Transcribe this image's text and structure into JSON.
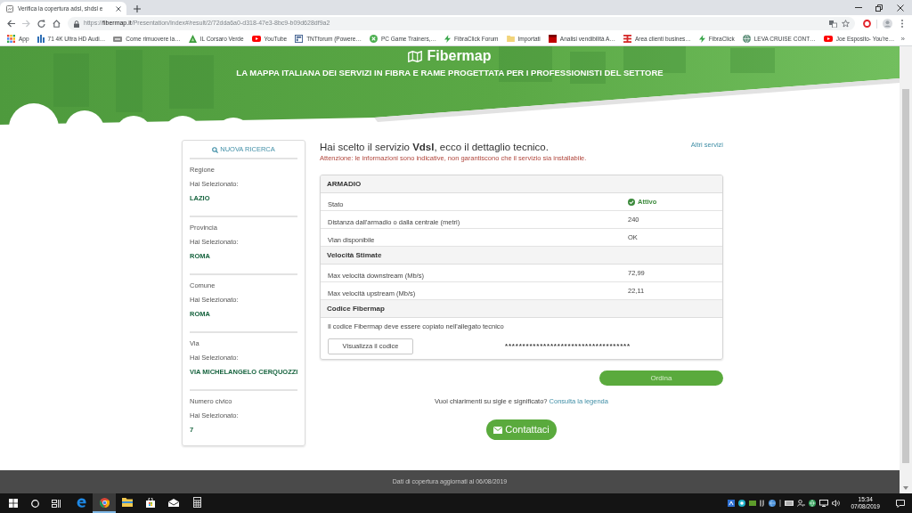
{
  "browser": {
    "tab": {
      "title": "Verifica la copertura adsl, shdsl e"
    },
    "nav": {
      "forward_disabled": true
    },
    "url": {
      "scheme": "https://",
      "host": "fibermap.it",
      "path": "/Presentation/Index#/result/2/72dda6a0-d318-47e3-8bc9-b09d628df9a2"
    },
    "bookmarks": {
      "items": [
        {
          "label": "App"
        },
        {
          "label": "71 4K Ultra HD Audi…"
        },
        {
          "label": "Come rimuovere la…"
        },
        {
          "label": "IL Corsaro Verde"
        },
        {
          "label": "YouTube"
        },
        {
          "label": "TNTforum (Powere…"
        },
        {
          "label": "PC Game Trainers,…"
        },
        {
          "label": "FibraClick Forum"
        },
        {
          "label": "Importati"
        },
        {
          "label": "Analisi vendibilità A…"
        },
        {
          "label": "Area clienti busines…"
        },
        {
          "label": "FibraClick"
        },
        {
          "label": "LEVA CRUISE CONT…"
        },
        {
          "label": "Joe Esposito- You're…"
        }
      ],
      "more": "»"
    }
  },
  "banner": {
    "logo": "Fibermap",
    "tagline": "LA MAPPA ITALIANA DEI SERVIZI IN FIBRA E RAME PROGETTATA PER I PROFESSIONISTI DEL SETTORE"
  },
  "search": {
    "new_search": "NUOVA RICERCA",
    "fields": [
      {
        "label": "Regione",
        "hint": "Hai Selezionato:",
        "value": "LAZIO"
      },
      {
        "label": "Provincia",
        "hint": "Hai Selezionato:",
        "value": "ROMA"
      },
      {
        "label": "Comune",
        "hint": "Hai Selezionato:",
        "value": "ROMA"
      },
      {
        "label": "Via",
        "hint": "Hai Selezionato:",
        "value": "VIA MICHELANGELO CERQUOZZI"
      },
      {
        "label": "Numero civico",
        "hint": "Hai Selezionato:",
        "value": "7"
      }
    ]
  },
  "detail": {
    "title": "Hai scelto il servizio **Vdsl**, ecco il dettaglio tecnico.",
    "other_services": "Altri servizi",
    "warning": "Attenzione: le informazioni sono indicative, non garantiscono che il servizio sia installabile.",
    "rows": [
      {
        "kind": "header",
        "label": "ARMADIO"
      },
      {
        "kind": "status",
        "label": "Stato",
        "value": "Attivo",
        "active": true
      },
      {
        "kind": "pair",
        "label": "Distanza dall'armadio o dalla centrale (metri)",
        "value": "240"
      },
      {
        "kind": "pair",
        "label": "Vlan disponibile",
        "value": "OK"
      },
      {
        "kind": "header",
        "label": "Velocità Stimate"
      },
      {
        "kind": "pair",
        "label": "Max velocità downstream (Mb/s)",
        "value": "72,99"
      },
      {
        "kind": "pair",
        "label": "Max velocità upstream (Mb/s)",
        "value": "22,11"
      },
      {
        "kind": "header",
        "label": "Codice Fibermap"
      },
      {
        "kind": "note",
        "label": "Il codice Fibermap deve essere copiato nell'allegato tecnico"
      },
      {
        "kind": "code",
        "button": "Visualizza il codice",
        "value": "************************************"
      }
    ],
    "order_button": "Ordina",
    "help": {
      "text": "Vuoi chiarimenti su sigle e significato?",
      "link": "Consulta la legenda"
    },
    "contact_button": "Contattaci"
  },
  "footer": {
    "text": "Dati di copertura aggiornati al 06/08/2019"
  },
  "taskbar": {
    "apps": [
      {
        "selected": false
      },
      {
        "selected": true
      },
      {
        "selected": false
      },
      {
        "selected": false
      },
      {
        "selected": false
      },
      {
        "selected": false
      }
    ],
    "clock": {
      "time": "15:34",
      "date": "07/08/2019"
    }
  }
}
